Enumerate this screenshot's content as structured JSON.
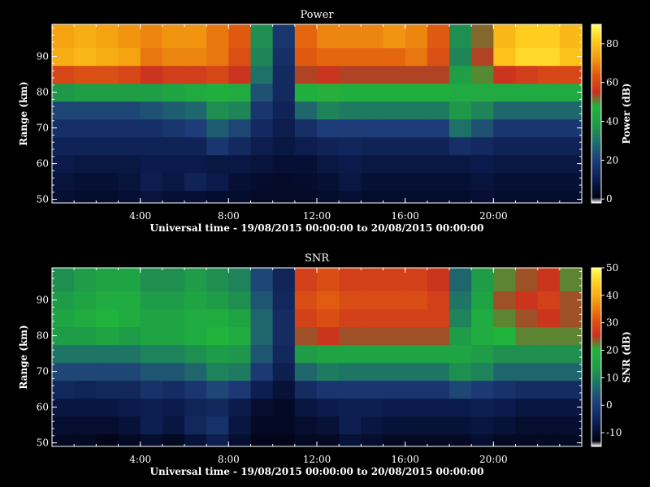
{
  "chart_data": [
    {
      "type": "heatmap",
      "title": "Power",
      "xlabel": "Universal time - 19/08/2015 00:00:00 to 20/08/2015 00:00:00",
      "ylabel": "Range (km)",
      "xlim": [
        "19/08/2015 00:00",
        "20/08/2015 00:00"
      ],
      "ylim": [
        49,
        99
      ],
      "x_ticks": [
        "4:00",
        "8:00",
        "12:00",
        "16:00",
        "20:00"
      ],
      "y_ticks": [
        50,
        60,
        70,
        80,
        90
      ],
      "colorbar": {
        "label": "Power (dB)",
        "range": [
          -2,
          90
        ],
        "ticks": [
          0,
          20,
          40,
          60,
          80
        ]
      },
      "x": [
        "00:00",
        "01:00",
        "02:00",
        "03:00",
        "04:00",
        "05:00",
        "06:00",
        "07:00",
        "08:00",
        "09:00",
        "10:00",
        "11:00",
        "12:00",
        "13:00",
        "14:00",
        "15:00",
        "16:00",
        "17:00",
        "18:00",
        "19:00",
        "20:00",
        "21:00",
        "22:00",
        "23:00"
      ],
      "y": [
        50,
        55,
        60,
        65,
        70,
        75,
        80,
        85,
        90,
        95
      ],
      "z": [
        [
          6,
          5,
          5,
          6,
          7,
          6,
          6,
          5,
          5,
          4,
          4,
          4,
          5,
          6,
          5,
          5,
          5,
          5,
          5,
          6,
          5,
          5,
          5,
          5
        ],
        [
          7,
          6,
          6,
          7,
          10,
          8,
          12,
          9,
          6,
          5,
          4,
          5,
          6,
          8,
          6,
          6,
          6,
          6,
          6,
          7,
          6,
          6,
          6,
          6
        ],
        [
          9,
          8,
          8,
          8,
          9,
          9,
          9,
          8,
          8,
          7,
          6,
          6,
          8,
          9,
          8,
          8,
          8,
          8,
          8,
          9,
          8,
          8,
          8,
          8
        ],
        [
          12,
          12,
          12,
          12,
          12,
          12,
          12,
          18,
          14,
          10,
          8,
          10,
          12,
          13,
          12,
          12,
          12,
          12,
          16,
          14,
          12,
          12,
          12,
          12
        ],
        [
          16,
          16,
          16,
          16,
          16,
          18,
          20,
          26,
          22,
          14,
          10,
          16,
          20,
          20,
          20,
          20,
          20,
          20,
          30,
          24,
          18,
          18,
          18,
          18
        ],
        [
          22,
          22,
          22,
          22,
          24,
          26,
          28,
          36,
          34,
          18,
          12,
          28,
          34,
          32,
          32,
          32,
          32,
          32,
          38,
          34,
          28,
          28,
          28,
          28
        ],
        [
          38,
          40,
          40,
          40,
          40,
          42,
          44,
          46,
          44,
          24,
          14,
          46,
          48,
          46,
          46,
          46,
          46,
          46,
          44,
          44,
          44,
          44,
          44,
          44
        ],
        [
          60,
          62,
          62,
          60,
          56,
          58,
          58,
          60,
          56,
          30,
          14,
          54,
          56,
          54,
          54,
          54,
          54,
          54,
          40,
          50,
          56,
          58,
          60,
          60
        ],
        [
          76,
          78,
          76,
          74,
          68,
          70,
          70,
          68,
          62,
          34,
          16,
          64,
          66,
          66,
          66,
          66,
          68,
          62,
          34,
          54,
          80,
          84,
          84,
          80
        ],
        [
          74,
          76,
          74,
          72,
          70,
          72,
          72,
          68,
          64,
          36,
          18,
          66,
          70,
          70,
          70,
          72,
          70,
          64,
          36,
          52,
          78,
          82,
          82,
          78
        ]
      ]
    },
    {
      "type": "heatmap",
      "title": "SNR",
      "xlabel": "Universal time - 19/08/2015 00:00:00 to 20/08/2015 00:00:00",
      "ylabel": "Range (km)",
      "xlim": [
        "19/08/2015 00:00",
        "20/08/2015 00:00"
      ],
      "ylim": [
        49,
        99
      ],
      "x_ticks": [
        "4:00",
        "8:00",
        "12:00",
        "16:00",
        "20:00"
      ],
      "y_ticks": [
        50,
        60,
        70,
        80,
        90
      ],
      "colorbar": {
        "label": "SNR (dB)",
        "range": [
          -15,
          50
        ],
        "ticks": [
          -10,
          0,
          10,
          20,
          30,
          40,
          50
        ]
      },
      "x": [
        "00:00",
        "01:00",
        "02:00",
        "03:00",
        "04:00",
        "05:00",
        "06:00",
        "07:00",
        "08:00",
        "09:00",
        "10:00",
        "11:00",
        "12:00",
        "13:00",
        "14:00",
        "15:00",
        "16:00",
        "17:00",
        "18:00",
        "19:00",
        "20:00",
        "21:00",
        "22:00",
        "23:00"
      ],
      "y": [
        50,
        55,
        60,
        65,
        70,
        75,
        80,
        85,
        90,
        95
      ],
      "z": [
        [
          -11,
          -11,
          -12,
          -11,
          -10,
          -11,
          -9,
          -6,
          -10,
          -12,
          -12,
          -11,
          -11,
          -9,
          -10,
          -11,
          -11,
          -11,
          -11,
          -10,
          -11,
          -11,
          -11,
          -11
        ],
        [
          -10,
          -10,
          -10,
          -9,
          -6,
          -8,
          -4,
          -2,
          -8,
          -11,
          -11,
          -10,
          -9,
          -6,
          -8,
          -9,
          -9,
          -9,
          -9,
          -8,
          -9,
          -10,
          -10,
          -10
        ],
        [
          -8,
          -8,
          -8,
          -7,
          -6,
          -7,
          -5,
          -4,
          -7,
          -10,
          -11,
          -8,
          -7,
          -6,
          -6,
          -7,
          -7,
          -7,
          -7,
          -6,
          -7,
          -8,
          -8,
          -8
        ],
        [
          -4,
          -5,
          -4,
          -4,
          -2,
          -3,
          -1,
          2,
          0,
          -6,
          -9,
          -3,
          -1,
          -1,
          -1,
          -1,
          -1,
          -1,
          2,
          0,
          -2,
          -3,
          -3,
          -3
        ],
        [
          2,
          2,
          2,
          2,
          4,
          4,
          6,
          10,
          9,
          0,
          -6,
          6,
          9,
          8,
          8,
          8,
          8,
          8,
          12,
          10,
          6,
          6,
          6,
          6
        ],
        [
          8,
          8,
          8,
          8,
          10,
          10,
          12,
          14,
          13,
          4,
          -4,
          14,
          16,
          16,
          16,
          16,
          16,
          16,
          16,
          14,
          12,
          12,
          12,
          12
        ],
        [
          14,
          14,
          16,
          14,
          16,
          16,
          18,
          20,
          18,
          6,
          -3,
          24,
          26,
          24,
          24,
          24,
          24,
          24,
          14,
          18,
          20,
          22,
          22,
          22
        ],
        [
          16,
          18,
          20,
          18,
          16,
          16,
          18,
          18,
          16,
          6,
          -3,
          28,
          30,
          28,
          28,
          28,
          28,
          28,
          10,
          18,
          22,
          24,
          26,
          24
        ],
        [
          14,
          16,
          18,
          18,
          14,
          14,
          16,
          14,
          12,
          4,
          -4,
          30,
          32,
          30,
          30,
          30,
          30,
          28,
          8,
          16,
          24,
          26,
          28,
          24
        ],
        [
          12,
          14,
          16,
          16,
          12,
          12,
          14,
          12,
          10,
          2,
          -5,
          28,
          30,
          28,
          28,
          28,
          28,
          26,
          6,
          14,
          22,
          24,
          26,
          22
        ]
      ]
    }
  ]
}
